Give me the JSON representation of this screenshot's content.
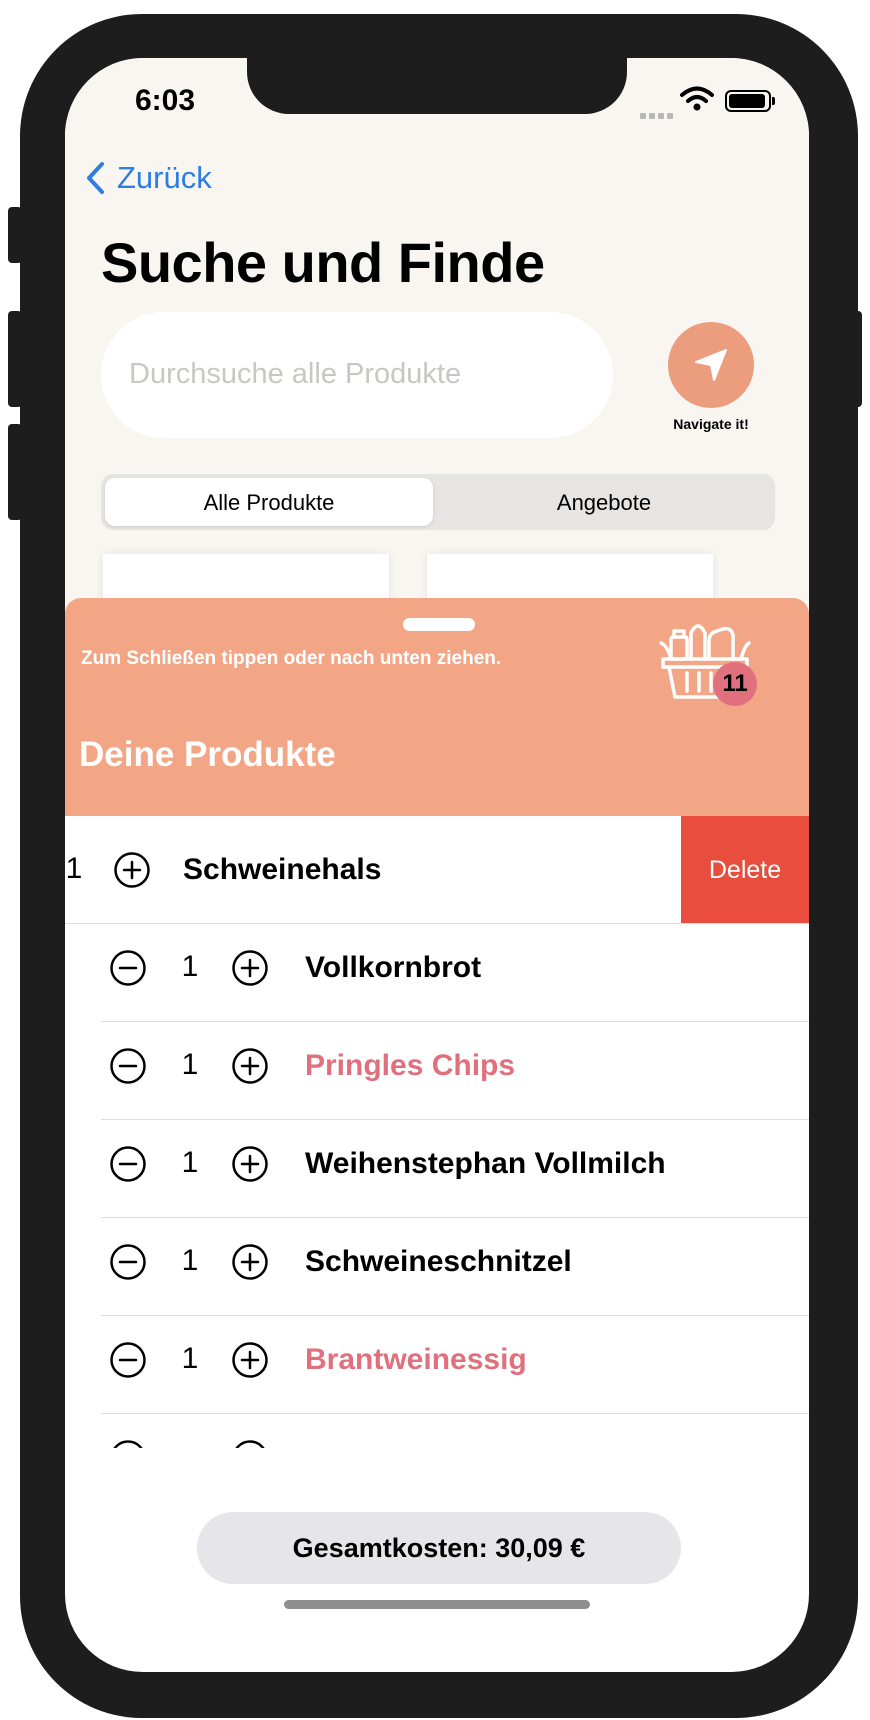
{
  "status_bar": {
    "time": "6:03"
  },
  "nav": {
    "back_label": "Zurück"
  },
  "page": {
    "title": "Suche und Finde",
    "search_placeholder": "Durchsuche alle Produkte",
    "navigate_label": "Navigate it!"
  },
  "segments": [
    {
      "label": "Alle Produkte",
      "selected": true
    },
    {
      "label": "Angebote",
      "selected": false
    }
  ],
  "sheet": {
    "hint": "Zum Schließen tippen oder nach unten ziehen.",
    "title": "Deine Produkte",
    "cart_count": "11",
    "delete_label": "Delete",
    "total_label": "Gesamtkosten: 30,09 €",
    "items": [
      {
        "qty": "1",
        "name": "Schweinehals",
        "color": "#000000",
        "swiped": true
      },
      {
        "qty": "1",
        "name": "Vollkornbrot",
        "color": "#000000"
      },
      {
        "qty": "1",
        "name": "Pringles Chips",
        "color": "#e0707d"
      },
      {
        "qty": "1",
        "name": "Weihenstephan Vollmilch",
        "color": "#000000"
      },
      {
        "qty": "1",
        "name": "Schweineschnitzel",
        "color": "#000000"
      },
      {
        "qty": "1",
        "name": "Brantweinessig",
        "color": "#e0707d"
      }
    ]
  },
  "colors": {
    "accent_blue": "#2f7de0",
    "sheet_header": "#f3a686",
    "navigate_button": "#eb9d7d",
    "delete_red": "#e84d3d",
    "offer_pink": "#e0707d"
  }
}
